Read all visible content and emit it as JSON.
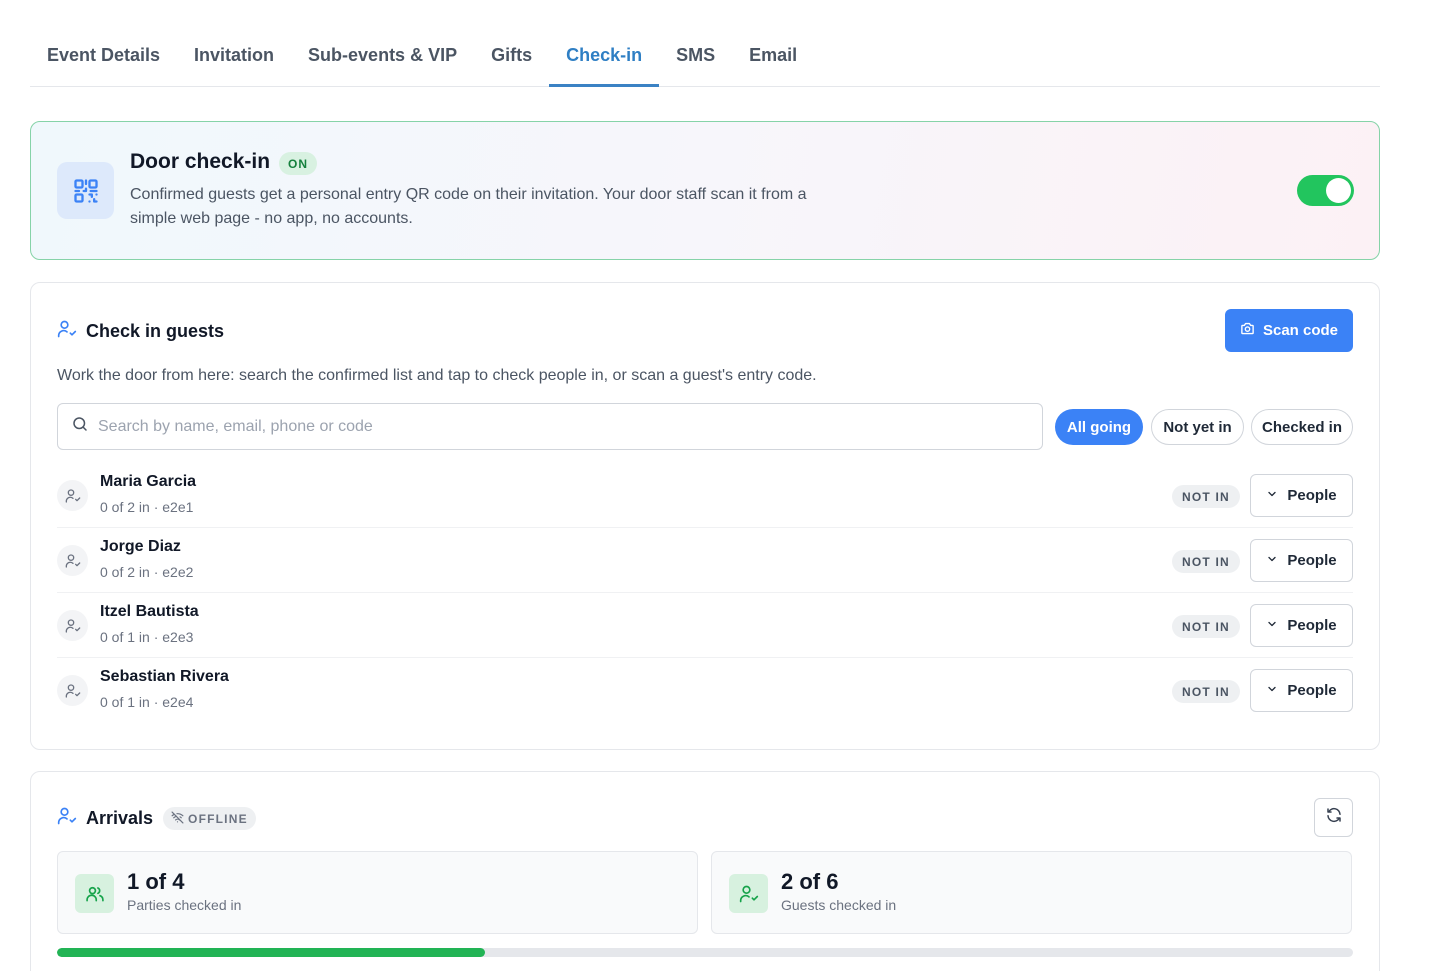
{
  "tabs": [
    {
      "label": "Event Details",
      "active": false
    },
    {
      "label": "Invitation",
      "active": false
    },
    {
      "label": "Sub-events & VIP",
      "active": false
    },
    {
      "label": "Gifts",
      "active": false
    },
    {
      "label": "Check-in",
      "active": true
    },
    {
      "label": "SMS",
      "active": false
    },
    {
      "label": "Email",
      "active": false
    }
  ],
  "door": {
    "icon": "qr-code-icon",
    "title": "Door check-in",
    "badge": "ON",
    "description": "Confirmed guests get a personal entry QR code on their invitation. Your door staff scan it from a simple web page - no app, no accounts.",
    "toggle_on": true
  },
  "guests": {
    "title": "Check in guests",
    "scan_label": "Scan code",
    "intro": "Work the door from here: search the confirmed list and tap to check people in, or scan a guest's entry code.",
    "search_placeholder": "Search by name, email, phone or code",
    "search_value": "",
    "filters": [
      {
        "label": "All going",
        "selected": true
      },
      {
        "label": "Not yet in",
        "selected": false
      },
      {
        "label": "Checked in",
        "selected": false
      }
    ],
    "rows": [
      {
        "name": "Maria Garcia",
        "meta": "0 of 2 in · e2e1",
        "status": "NOT IN",
        "action": "People"
      },
      {
        "name": "Jorge Diaz",
        "meta": "0 of 2 in · e2e2",
        "status": "NOT IN",
        "action": "People"
      },
      {
        "name": "Itzel Bautista",
        "meta": "0 of 1 in · e2e3",
        "status": "NOT IN",
        "action": "People"
      },
      {
        "name": "Sebastian Rivera",
        "meta": "0 of 1 in · e2e4",
        "status": "NOT IN",
        "action": "People"
      }
    ]
  },
  "arrivals": {
    "title": "Arrivals",
    "badge": "OFFLINE",
    "stats": [
      {
        "value": "1 of 4",
        "label": "Parties checked in",
        "icon": "users-icon"
      },
      {
        "value": "2 of 6",
        "label": "Guests checked in",
        "icon": "user-check-icon"
      }
    ],
    "progress_fraction": 0.33
  },
  "colors": {
    "accent": "#3b82f6",
    "active_tab": "#2f7fc4",
    "success": "#22c55e"
  }
}
